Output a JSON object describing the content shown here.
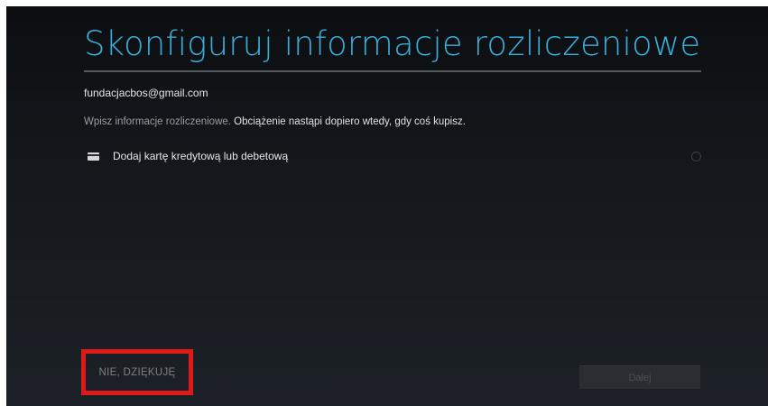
{
  "header": {
    "title": "Skonfiguruj informacje rozliczeniowe"
  },
  "account": {
    "email": "fundacjacbos@gmail.com"
  },
  "info": {
    "muted_text": "Wpisz informacje rozliczeniowe.",
    "strong_text": "Obciążenie nastąpi dopiero wtedy, gdy coś kupisz."
  },
  "payment_options": [
    {
      "label": "Dodaj kartę kredytową lub debetową",
      "icon": "credit-card-icon",
      "selected": false
    }
  ],
  "actions": {
    "skip_label": "NIE, DZIĘKUJĘ",
    "next_label": "Dalej",
    "next_enabled": false
  },
  "colors": {
    "title": "#38aed8",
    "highlight_box": "#e01818",
    "background_top": "#0c0e11",
    "background_bottom": "#1c2127"
  }
}
